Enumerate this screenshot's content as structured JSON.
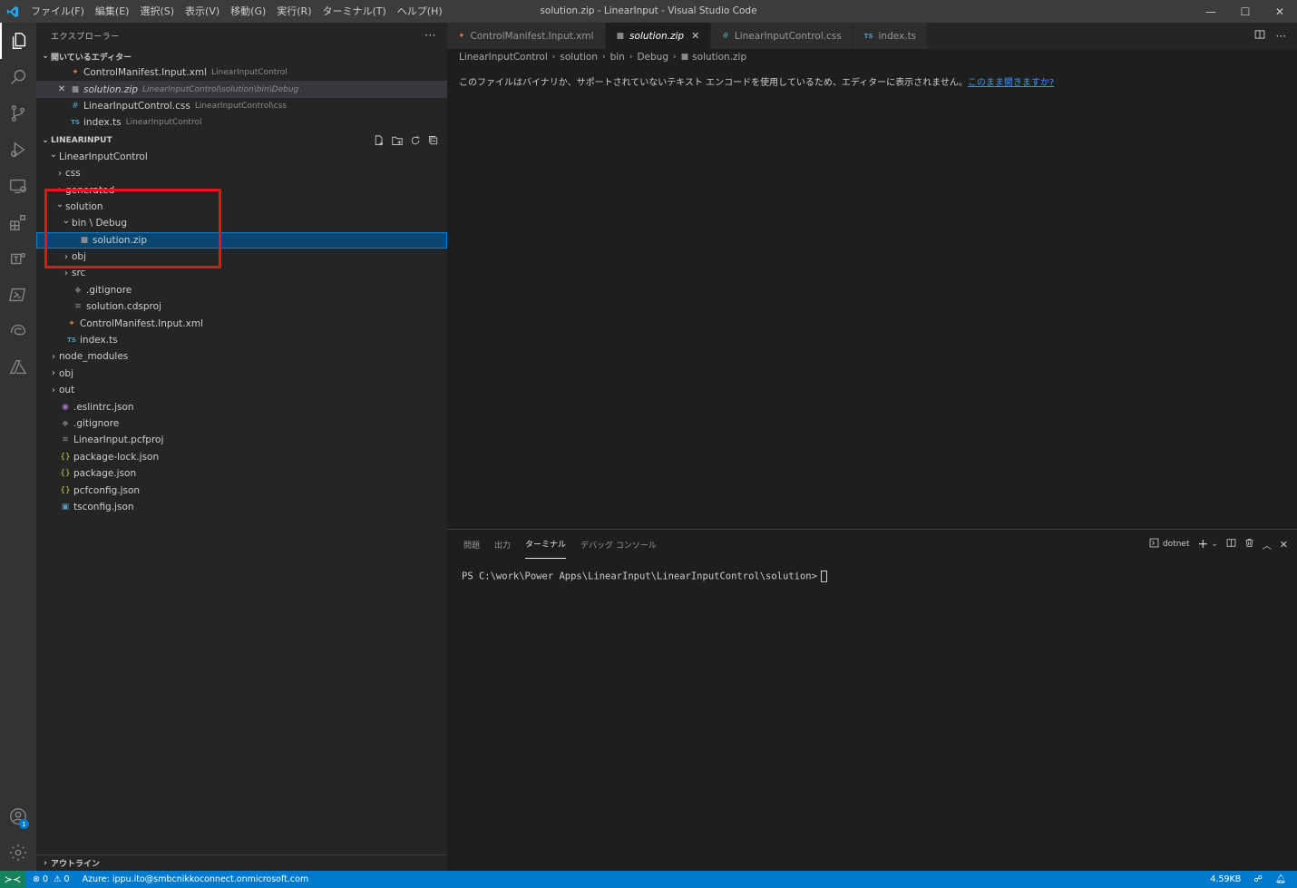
{
  "window": {
    "title": "solution.zip - LinearInput - Visual Studio Code",
    "menu": [
      "ファイル(F)",
      "編集(E)",
      "選択(S)",
      "表示(V)",
      "移動(G)",
      "実行(R)",
      "ターミナル(T)",
      "ヘルプ(H)"
    ],
    "controls": {
      "minimize": "—",
      "maximize": "☐",
      "close": "✕"
    }
  },
  "activity_bar": [
    "explorer-icon",
    "search-icon",
    "source-control-icon",
    "run-debug-icon",
    "remote-explorer-icon",
    "extensions-icon",
    "teams-icon",
    "powershell-icon",
    "edge-icon",
    "azure-icon",
    "accounts-icon",
    "settings-gear-icon"
  ],
  "accounts_badge": "1",
  "explorer": {
    "title": "エクスプローラー",
    "more": "···",
    "open_editors": {
      "title": "開いているエディター",
      "items": [
        {
          "icon": "xml",
          "name": "ControlManifest.Input.xml",
          "desc": "LinearInputControl"
        },
        {
          "icon": "file",
          "name": "solution.zip",
          "desc": "LinearInputControl\\solution\\bin\\Debug"
        },
        {
          "icon": "css",
          "name": "LinearInputControl.css",
          "desc": "LinearInputControl\\css"
        },
        {
          "icon": "ts",
          "name": "index.ts",
          "desc": "LinearInputControl"
        }
      ]
    },
    "workspace": {
      "title": "LINEARINPUT",
      "tree": [
        {
          "depth": 1,
          "chev": "v",
          "icon": "",
          "name": "LinearInputControl"
        },
        {
          "depth": 2,
          "chev": ">",
          "icon": "",
          "name": "css"
        },
        {
          "depth": 2,
          "chev": ">",
          "icon": "",
          "name": "generated"
        },
        {
          "depth": 2,
          "chev": "v",
          "icon": "",
          "name": "solution"
        },
        {
          "depth": 3,
          "chev": "v",
          "icon": "",
          "name": "bin \\ Debug"
        },
        {
          "depth": 4,
          "chev": "",
          "icon": "file",
          "name": "solution.zip"
        },
        {
          "depth": 3,
          "chev": ">",
          "icon": "",
          "name": "obj"
        },
        {
          "depth": 3,
          "chev": ">",
          "icon": "",
          "name": "src"
        },
        {
          "depth": 3,
          "chev": "",
          "icon": "git",
          "name": ".gitignore"
        },
        {
          "depth": 3,
          "chev": "",
          "icon": "proj",
          "name": "solution.cdsproj"
        },
        {
          "depth": 2,
          "chev": "",
          "icon": "xml",
          "name": "ControlManifest.Input.xml"
        },
        {
          "depth": 2,
          "chev": "",
          "icon": "ts",
          "name": "index.ts"
        },
        {
          "depth": 1,
          "chev": ">",
          "icon": "",
          "name": "node_modules"
        },
        {
          "depth": 1,
          "chev": ">",
          "icon": "",
          "name": "obj"
        },
        {
          "depth": 1,
          "chev": ">",
          "icon": "",
          "name": "out"
        },
        {
          "depth": 1,
          "chev": "",
          "icon": "eslint",
          "name": ".eslintrc.json"
        },
        {
          "depth": 1,
          "chev": "",
          "icon": "git",
          "name": ".gitignore"
        },
        {
          "depth": 1,
          "chev": "",
          "icon": "proj",
          "name": "LinearInput.pcfproj"
        },
        {
          "depth": 1,
          "chev": "",
          "icon": "json",
          "name": "package-lock.json"
        },
        {
          "depth": 1,
          "chev": "",
          "icon": "json",
          "name": "package.json"
        },
        {
          "depth": 1,
          "chev": "",
          "icon": "json",
          "name": "pcfconfig.json"
        },
        {
          "depth": 1,
          "chev": "",
          "icon": "tsconfig",
          "name": "tsconfig.json"
        }
      ]
    },
    "outline_title": "アウトライン"
  },
  "editor": {
    "tabs": [
      {
        "icon": "xml",
        "name": "ControlManifest.Input.xml"
      },
      {
        "icon": "file",
        "name": "solution.zip",
        "close": "✕"
      },
      {
        "icon": "css",
        "name": "LinearInputControl.css"
      },
      {
        "icon": "ts",
        "name": "index.ts"
      }
    ],
    "breadcrumbs": [
      "LinearInputControl",
      "solution",
      "bin",
      "Debug",
      "solution.zip"
    ],
    "message": "このファイルはバイナリか、サポートされていないテキスト エンコードを使用しているため、エディターに表示されません。",
    "link": "このまま開きますか?"
  },
  "panel": {
    "tabs": [
      "問題",
      "出力",
      "ターミナル",
      "デバッグ コンソール"
    ],
    "terminal_name": "dotnet",
    "prompt": "PS C:\\work\\Power Apps\\LinearInput\\LinearInputControl\\solution>"
  },
  "statusbar": {
    "errors": "0",
    "warnings": "0",
    "account": "Azure: ippu.ito@smbcnikkoconnect.onmicrosoft.com",
    "size": "4.59KB"
  },
  "colors": {
    "accent": "#007acc",
    "highlight_box": "#e8141b",
    "selection": "#094771"
  }
}
